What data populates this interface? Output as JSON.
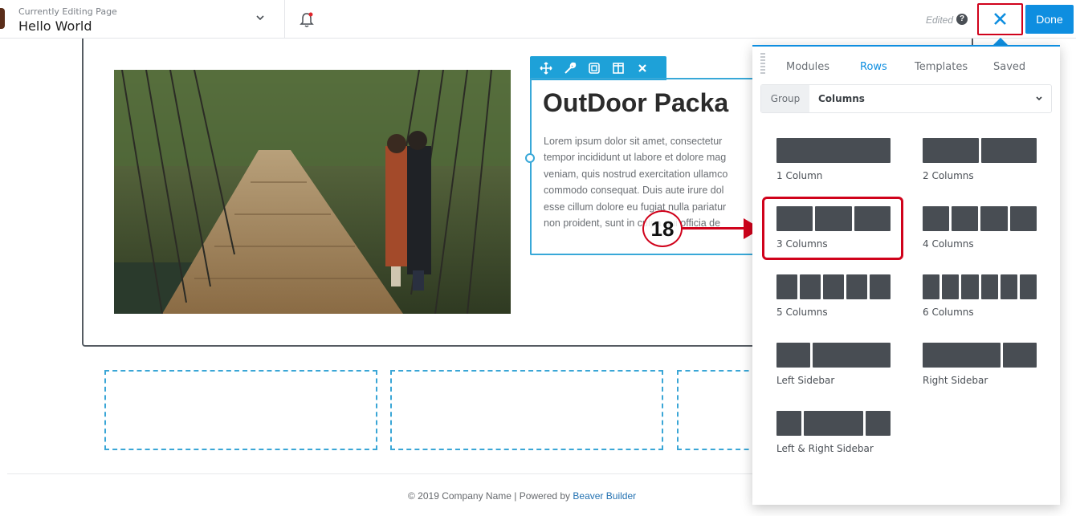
{
  "topbar": {
    "current_label": "Currently Editing Page",
    "page_title": "Hello World",
    "edited_label": "Edited",
    "help_glyph": "?",
    "done_label": "Done",
    "accent_color": "#0e8ee0"
  },
  "module": {
    "heading": "OutDoor Packa",
    "body_lines": [
      "Lorem ipsum dolor sit amet, consectetur",
      "tempor incididunt ut labore et dolore mag",
      "veniam, quis nostrud exercitation ullamco",
      "commodo consequat. Duis aute irure dol",
      "esse cillum dolore eu fugiat nulla pariatur",
      "non proident, sunt in culpa qui officia de"
    ],
    "toolbar_icons": [
      "move-icon",
      "wrench-icon",
      "duplicate-icon",
      "columns-icon",
      "remove-icon"
    ]
  },
  "footer": {
    "text": "© 2019 Company Name | Powered by ",
    "link": "Beaver Builder"
  },
  "annotation": {
    "step_number": "18",
    "color": "#d0021b"
  },
  "panel": {
    "tabs": [
      "Modules",
      "Rows",
      "Templates",
      "Saved"
    ],
    "active_tab": "Rows",
    "group_label": "Group",
    "group_value": "Columns",
    "layouts": [
      {
        "label": "1 Column"
      },
      {
        "label": "2 Columns"
      },
      {
        "label": "3 Columns"
      },
      {
        "label": "4 Columns"
      },
      {
        "label": "5 Columns"
      },
      {
        "label": "6 Columns"
      },
      {
        "label": "Left Sidebar"
      },
      {
        "label": "Right Sidebar"
      },
      {
        "label": "Left & Right Sidebar"
      }
    ]
  }
}
